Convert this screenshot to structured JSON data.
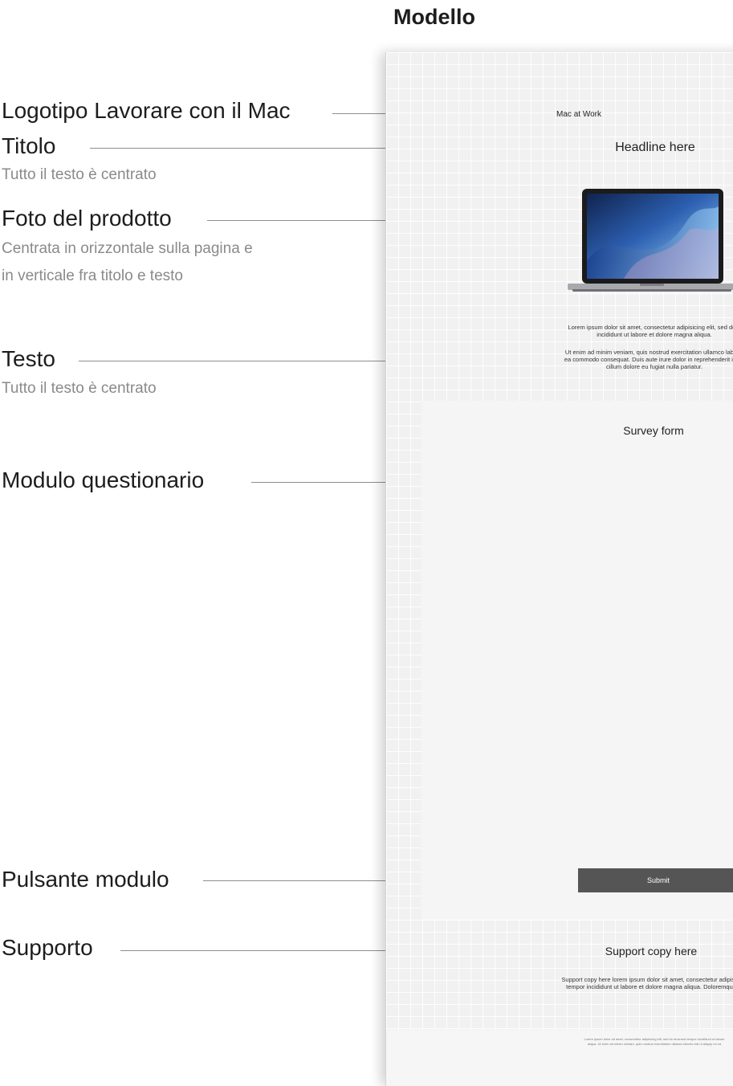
{
  "page_title": "Modello",
  "annotations": {
    "logo": {
      "label": "Logotipo Lavorare con il Mac"
    },
    "headline": {
      "label": "Titolo",
      "note": "Tutto il testo è centrato"
    },
    "product": {
      "label": "Foto del prodotto",
      "note_line1": "Centrata in orizzontale sulla pagina e",
      "note_line2": "in verticale fra titolo e testo"
    },
    "body": {
      "label": "Testo",
      "note": "Tutto il testo è centrato"
    },
    "survey": {
      "label": "Modulo questionario"
    },
    "button": {
      "label": "Pulsante modulo"
    },
    "support": {
      "label": "Supporto"
    }
  },
  "template": {
    "logo_text": "Mac at Work",
    "headline": "Headline here",
    "body_p1_line1": "Lorem ipsum dolor sit amet, consectetur adipisicing elit, sed do e",
    "body_p1_line2": "incididunt ut labore et dolore magna aliqua.",
    "body_p2_line1": "Ut enim ad minim veniam, quis nostrud exercitation ullamco laboris",
    "body_p2_line2": "ea commodo consequat. Duis aute irure dolor in reprehenderit in vo",
    "body_p2_line3": "cillum dolore eu fugiat nulla pariatur.",
    "survey_title": "Survey form",
    "submit_label": "Submit",
    "support_heading": "Support copy here",
    "support_line1": "Support copy here lorem ipsum dolor sit amet, consectetur adipisicing",
    "support_line2": "tempor incididunt ut labore et dolore magna aliqua. Doloremque la",
    "footer_line1": "Lorem ipsum dolor sit amet, consectetur adipiscing elit, sed do eiusmod tempor incididunt ut labore",
    "footer_line2": "aliqua. Ut enim ad minim veniam, quis nostrud exercitation ullamco laboris nisi ut aliquip ex ea"
  },
  "colors": {
    "sheet_bg": "#f1f1f1",
    "button_bg": "#555555",
    "leader_line": "#8e8e8e",
    "note_text": "#8a8a8a"
  },
  "icons": [
    "macbook-image"
  ]
}
